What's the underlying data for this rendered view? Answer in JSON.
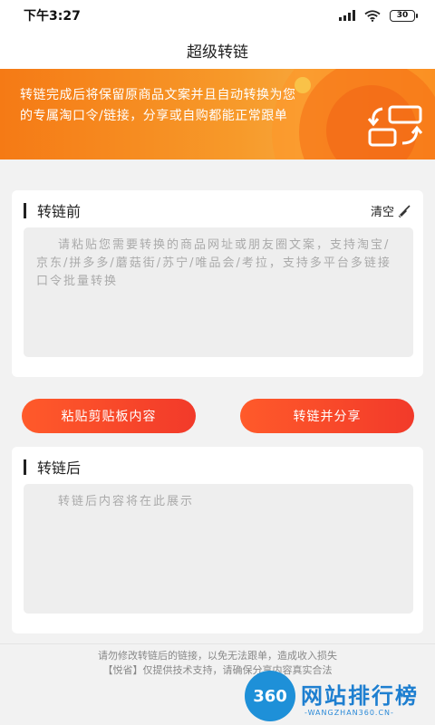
{
  "status_bar": {
    "time": "下午3:27",
    "battery": "30",
    "signal_icon": "signal-icon",
    "wifi_icon": "wifi-icon"
  },
  "nav": {
    "title": "超级转链"
  },
  "banner": {
    "text": "转链完成后将保留原商品文案并且自动转换为您的专属淘口令/链接，分享或自购都能正常跟单",
    "icon": "convert-icon",
    "colors": {
      "start": "#f57a15",
      "end": "#f7a53a"
    }
  },
  "before": {
    "title": "转链前",
    "clear_label": "清空",
    "placeholder": "请粘贴您需要转换的商品网址或朋友圈文案，支持淘宝/京东/拼多多/蘑菇街/苏宁/唯品会/考拉，支持多平台多链接口令批量转换"
  },
  "buttons": {
    "paste": "粘贴剪贴板内容",
    "share": "转链并分享",
    "color": "#f23a2a"
  },
  "after": {
    "title": "转链后",
    "placeholder": "转链后内容将在此展示"
  },
  "footer": {
    "line1": "请勿修改转链后的链接，以免无法跟单，造成收入损失",
    "line2": "【悦省】仅提供技术支持，请确保分享内容真实合法"
  },
  "watermark": {
    "logo": "360",
    "title": "网站排行榜",
    "subtitle": "-WANGZHAN360.CN-"
  }
}
